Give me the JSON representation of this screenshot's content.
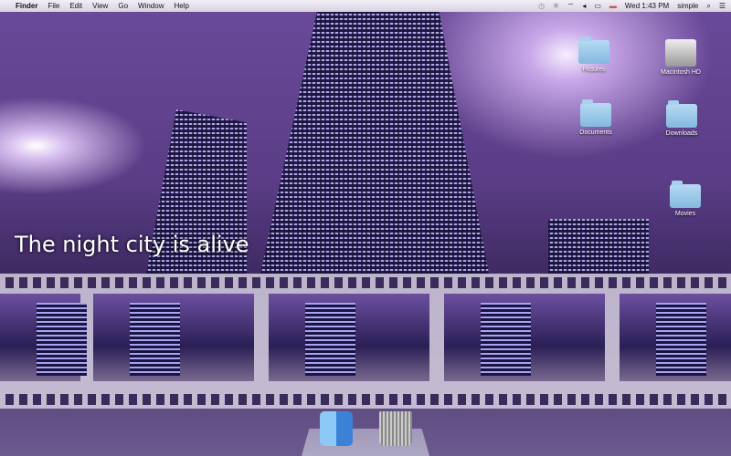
{
  "menubar": {
    "apple": "",
    "app": "Finder",
    "menus": [
      "File",
      "Edit",
      "View",
      "Go",
      "Window",
      "Help"
    ],
    "status": {
      "time_machine": "◷",
      "bluetooth": "✱",
      "wifi": "⌔",
      "volume": "◂",
      "battery": "▭",
      "flag": "▬",
      "clock": "Wed 1:43 PM",
      "user": "simple",
      "spotlight": "⌕",
      "notifications": "☰"
    }
  },
  "wallpaper": {
    "caption": "The night city is alive"
  },
  "desktop": {
    "icons": [
      {
        "label": "Pictures"
      },
      {
        "label": "Macintosh HD"
      },
      {
        "label": "Documents"
      },
      {
        "label": "Downloads"
      },
      {
        "label": "Movies"
      }
    ]
  },
  "dock": {
    "items": [
      "Finder",
      "Trash"
    ]
  }
}
